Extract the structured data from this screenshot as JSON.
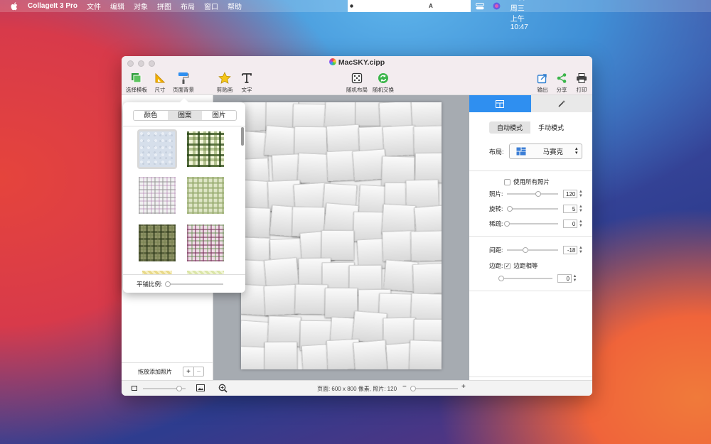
{
  "menubar": {
    "app": "CollageIt 3 Pro",
    "menus": [
      "文件",
      "编辑",
      "对象",
      "拼图",
      "布局",
      "窗口",
      "帮助"
    ],
    "input_method": "A",
    "clock": "1月13日 周三 上午10:47"
  },
  "window": {
    "title": "MacSKY.cipp"
  },
  "toolbar": {
    "template": "选择模板",
    "size": "尺寸",
    "background": "页面背景",
    "clipart": "剪贴画",
    "text": "文字",
    "random_layout": "随机布局",
    "random_swap": "随机交换",
    "export": "输出",
    "share": "分享",
    "print": "打印"
  },
  "popover": {
    "tabs": [
      "颜色",
      "图案",
      "图片"
    ],
    "active_tab": "图案",
    "tile_label": "平铺比例:",
    "tile_scale": 0.04
  },
  "left_panel": {
    "drop_label": "拖放添加照片",
    "add": "+",
    "remove": "−"
  },
  "right_panel": {
    "mode_auto": "自动模式",
    "mode_manual": "手动模式",
    "layout_label": "布局:",
    "layout_value": "马赛克",
    "use_all_photos": "使用所有照片",
    "photos_label": "照片:",
    "photos_value": "120",
    "photos_level": 0.6,
    "rotation_label": "旋转:",
    "rotation_value": "5",
    "rotation_level": 0.05,
    "sparse_label": "稀疏:",
    "sparse_value": "0",
    "sparse_level": 0.0,
    "spacing_label": "间距:",
    "spacing_value": "-18",
    "spacing_level": 0.35,
    "margin_label": "边距:",
    "margin_equal": "边距相等",
    "margin_value": "0",
    "margin_level": 0.0
  },
  "statusbar": {
    "info": "页面: 600 x 800 像素, 照片: 120",
    "zoom_minus": "−",
    "zoom_plus": "+",
    "thumb_level": 0.85,
    "zoom_level": 0.05
  }
}
